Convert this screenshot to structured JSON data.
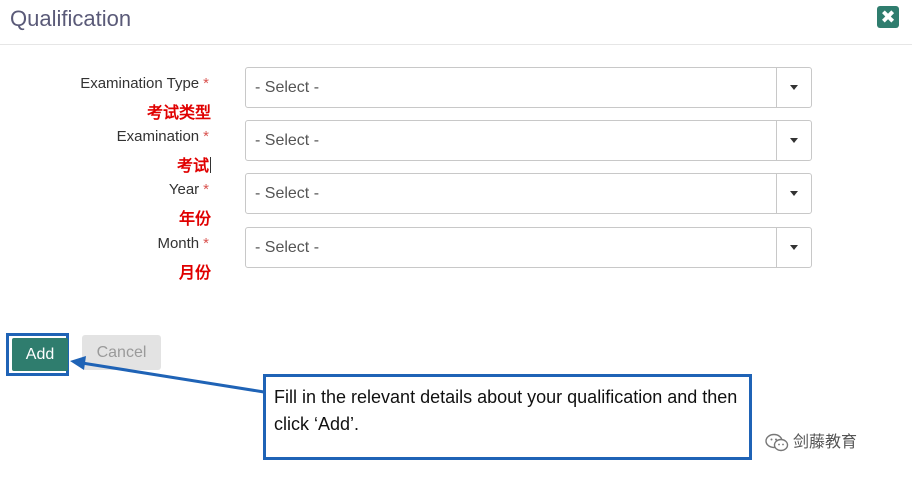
{
  "dialog": {
    "title": "Qualification",
    "close_icon": "close-icon"
  },
  "fields": [
    {
      "label": "Examination Type",
      "required_mark": "*",
      "translation": "考试类型",
      "value": "- Select -"
    },
    {
      "label": "Examination",
      "required_mark": "*",
      "translation": "考试",
      "value": "- Select -"
    },
    {
      "label": "Year",
      "required_mark": "*",
      "translation": "年份",
      "value": "- Select -"
    },
    {
      "label": "Month",
      "required_mark": "*",
      "translation": "月份",
      "value": "- Select -"
    }
  ],
  "buttons": {
    "add_label": "Add",
    "cancel_label": "Cancel"
  },
  "annotation": {
    "text": "Fill in the relevant details about your qualification and then click ‘Add’.",
    "accent_color": "#1f63b6"
  },
  "watermark": {
    "text": "剑藤教育"
  },
  "colors": {
    "primary": "#2f7d6e",
    "required": "#d9534f",
    "translation": "#e00000"
  }
}
